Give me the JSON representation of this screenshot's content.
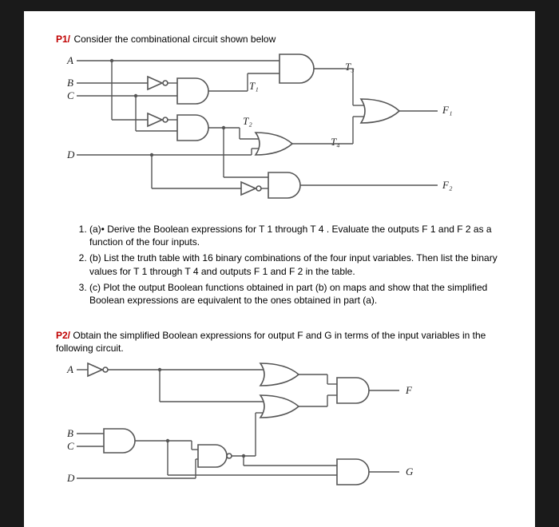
{
  "p1": {
    "label": "P1/",
    "title": " Consider the combinational circuit shown below",
    "inputs": {
      "A": "A",
      "B": "B",
      "C": "C",
      "D": "D"
    },
    "signals": {
      "T1": "T₁",
      "T2": "T₂",
      "T3": "T₃",
      "T4": "T₄",
      "F1": "F₁",
      "F2": "F₂"
    },
    "questions": {
      "q1": "(a)• Derive the Boolean expressions for T 1 through T 4 . Evaluate the outputs F 1 and F 2 as a function of the four inputs.",
      "q2": "(b) List the truth table with 16 binary combinations of the four input variables. Then list the binary values for T 1 through T 4 and outputs F 1 and F 2 in the table.",
      "q3": "(c) Plot the output Boolean functions obtained in part (b) on maps and show that the simplified Boolean expressions are equivalent to the ones obtained in part (a)."
    }
  },
  "p2": {
    "label": "P2/",
    "title": " Obtain the simplified Boolean expressions for output F and G in terms of the input variables in the following circuit.",
    "inputs": {
      "A": "A",
      "B": "B",
      "C": "C",
      "D": "D"
    },
    "outputs": {
      "F": "F",
      "G": "G"
    }
  }
}
